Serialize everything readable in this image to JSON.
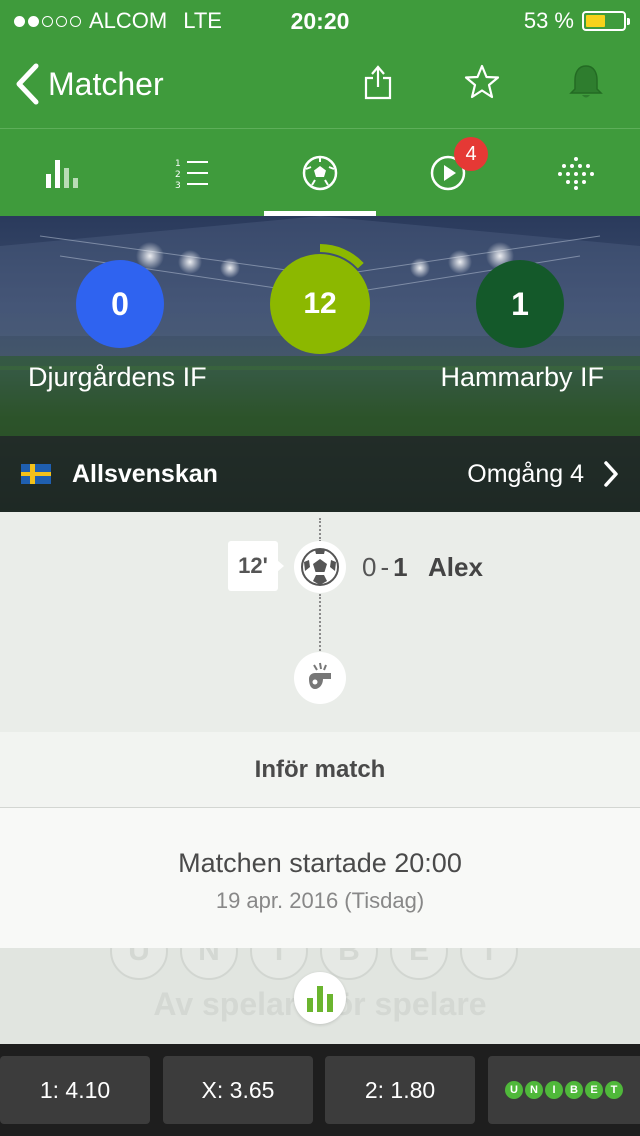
{
  "status_bar": {
    "carrier": "ALCOM",
    "network": "LTE",
    "time": "20:20",
    "battery_percent": "53 %",
    "battery_level": 0.53,
    "signal_bars_filled": 2,
    "signal_bars_total": 5
  },
  "nav": {
    "back_label": "Matcher"
  },
  "tabs": [
    {
      "name": "stats",
      "icon": "bar-chart-icon",
      "active": false
    },
    {
      "name": "standings",
      "icon": "numbered-list-icon",
      "active": false
    },
    {
      "name": "match",
      "icon": "football-icon",
      "active": true
    },
    {
      "name": "video",
      "icon": "play-icon",
      "active": false,
      "badge": "4"
    },
    {
      "name": "lineup",
      "icon": "formation-icon",
      "active": false
    }
  ],
  "match": {
    "home_team": "Djurgårdens IF",
    "home_score": "0",
    "away_team": "Hammarby IF",
    "away_score": "1",
    "minute": "12",
    "minute_progress": 0.13,
    "league": "Allsvenskan",
    "round": "Omgång 4",
    "colors": {
      "home": "#2f63f0",
      "away": "#14592a",
      "minute": "#8cb800",
      "brand": "#3f9b3c"
    }
  },
  "events": {
    "goal_minute": "12'",
    "goal_score_home": "0",
    "goal_score_sep": "-",
    "goal_score_away": "1",
    "goal_player": "Alex"
  },
  "pre_match": {
    "header": "Inför match",
    "start_text": "Matchen startade 20:00",
    "date_text": "19 apr. 2016 (Tisdag)"
  },
  "promo": {
    "letters": [
      "U",
      "N",
      "I",
      "B",
      "E",
      "T"
    ],
    "slogan": "Av spelare för spelare"
  },
  "odds": {
    "home": "1: 4.10",
    "draw": "X: 3.65",
    "away": "2: 1.80",
    "bookmaker_letters": [
      "U",
      "N",
      "I",
      "B",
      "E",
      "T"
    ]
  }
}
